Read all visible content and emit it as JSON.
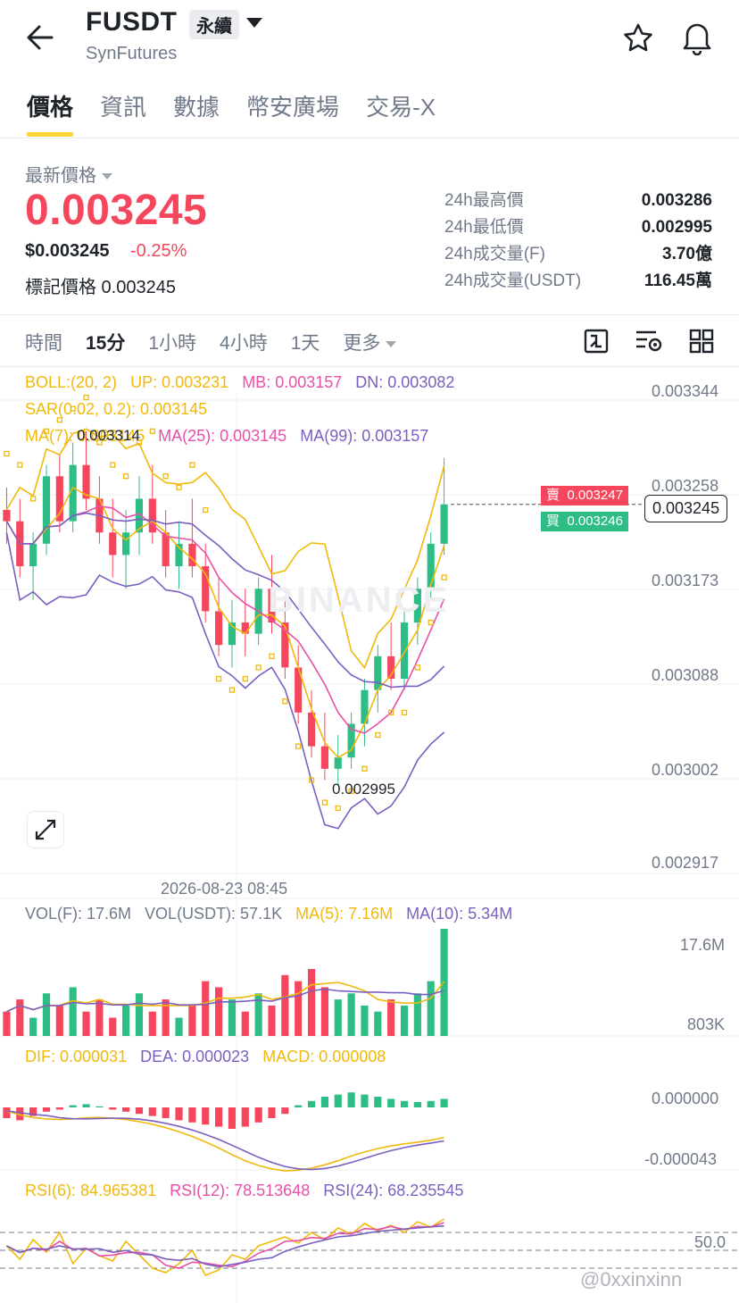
{
  "header": {
    "back_icon": "arrow-left-icon",
    "symbol": "FUSDT",
    "contract_type": "永續",
    "exchange": "SynFutures",
    "star_icon": "star-icon",
    "bell_icon": "bell-icon"
  },
  "tabs": [
    {
      "label": "價格",
      "active": true
    },
    {
      "label": "資訊",
      "active": false
    },
    {
      "label": "數據",
      "active": false
    },
    {
      "label": "幣安廣場",
      "active": false
    },
    {
      "label": "交易-X",
      "active": false
    }
  ],
  "summary": {
    "latest_label": "最新價格",
    "last_price": "0.003245",
    "usd_price": "$0.003245",
    "change": "-0.25%",
    "mark_label": "標記價格 0.003245",
    "stats": [
      {
        "label": "24h最高價",
        "value": "0.003286"
      },
      {
        "label": "24h最低價",
        "value": "0.002995"
      },
      {
        "label": "24h成交量(F)",
        "value": "3.70億"
      },
      {
        "label": "24h成交量(USDT)",
        "value": "116.45萬"
      }
    ]
  },
  "intervals": [
    {
      "label": "時間",
      "active": false
    },
    {
      "label": "15分",
      "active": true
    },
    {
      "label": "1小時",
      "active": false
    },
    {
      "label": "4小時",
      "active": false
    },
    {
      "label": "1天",
      "active": false
    },
    {
      "label": "更多",
      "active": false
    }
  ],
  "toolbar_icons": [
    "chart-type-icon",
    "indicator-settings-icon",
    "layout-grid-icon"
  ],
  "indicators": {
    "boll": {
      "label": "BOLL:(20, 2)",
      "up": "UP: 0.003231",
      "mb": "MB: 0.003157",
      "dn": "DN: 0.003082"
    },
    "sar": "SAR(0.02, 0.2): 0.003145",
    "ma": {
      "ma7": "MA(7): 0.003145",
      "ma25": "MA(25): 0.003145",
      "ma99": "MA(99): 0.003157"
    },
    "vol": {
      "volf": "VOL(F): 17.6M",
      "volusdt": "VOL(USDT): 57.1K",
      "ma5": "MA(5): 7.16M",
      "ma10": "MA(10): 5.34M"
    },
    "macd": {
      "dif": "DIF: 0.000031",
      "dea": "DEA: 0.000023",
      "macd": "MACD: 0.000008"
    },
    "rsi": {
      "rsi6": "RSI(6): 84.965381",
      "rsi12": "RSI(12): 78.513648",
      "rsi24": "RSI(24): 68.235545"
    }
  },
  "price_axis": [
    "0.003344",
    "0.003258",
    "0.003173",
    "0.003088",
    "0.003002",
    "0.002917"
  ],
  "chart_annotations": {
    "high": "0.003314",
    "low": "0.002995",
    "time": "2026-08-23 08:45"
  },
  "order_tags": {
    "sell_label": "賣",
    "sell_value": "0.003247",
    "buy_label": "買",
    "buy_value": "0.003246",
    "current": "0.003245"
  },
  "vol_axis": [
    "17.6M",
    "803K"
  ],
  "macd_axis": [
    "0.000000",
    "-0.000043"
  ],
  "rsi_axis": [
    "50.0"
  ],
  "watermark": "BINANCE",
  "footer_watermark": "@0xxinxinn",
  "colors": {
    "up": "#2ebd85",
    "down": "#f6465d",
    "accent": "#fcd535",
    "boll": "#f0b90b",
    "ma25": "#e84fa8",
    "ma99": "#7b5fc0"
  },
  "chart_data": {
    "type": "candlestick",
    "interval": "15分",
    "ylim": [
      0.002917,
      0.003344
    ],
    "series_overlays": [
      "BOLL",
      "SAR",
      "MA(7)",
      "MA(25)",
      "MA(99)"
    ],
    "candles": [
      [
        0.00324,
        0.00326,
        0.00321,
        0.00323
      ],
      [
        0.00323,
        0.00325,
        0.00318,
        0.00319
      ],
      [
        0.00319,
        0.00322,
        0.00316,
        0.00321
      ],
      [
        0.00321,
        0.00328,
        0.0032,
        0.00327
      ],
      [
        0.00327,
        0.00329,
        0.00322,
        0.00323
      ],
      [
        0.00323,
        0.0033,
        0.00322,
        0.00328
      ],
      [
        0.00328,
        0.00331,
        0.00324,
        0.00325
      ],
      [
        0.00325,
        0.00327,
        0.00321,
        0.00322
      ],
      [
        0.00322,
        0.00325,
        0.00318,
        0.0032
      ],
      [
        0.0032,
        0.00324,
        0.00317,
        0.00322
      ],
      [
        0.00322,
        0.00327,
        0.0032,
        0.00325
      ],
      [
        0.00325,
        0.00328,
        0.00321,
        0.00322
      ],
      [
        0.00322,
        0.00324,
        0.00318,
        0.00319
      ],
      [
        0.00319,
        0.00323,
        0.00317,
        0.00321
      ],
      [
        0.00321,
        0.00325,
        0.00318,
        0.00319
      ],
      [
        0.00319,
        0.00321,
        0.00314,
        0.00315
      ],
      [
        0.00315,
        0.00318,
        0.00311,
        0.00312
      ],
      [
        0.00312,
        0.00316,
        0.0031,
        0.00314
      ],
      [
        0.00314,
        0.00317,
        0.00311,
        0.00313
      ],
      [
        0.00313,
        0.00318,
        0.00312,
        0.00317
      ],
      [
        0.00317,
        0.0032,
        0.00313,
        0.00314
      ],
      [
        0.00314,
        0.00316,
        0.00309,
        0.0031
      ],
      [
        0.0031,
        0.00312,
        0.00305,
        0.00306
      ],
      [
        0.00306,
        0.00308,
        0.00302,
        0.00303
      ],
      [
        0.00303,
        0.00306,
        0.003,
        0.00301
      ],
      [
        0.00301,
        0.00304,
        0.002995,
        0.00302
      ],
      [
        0.00302,
        0.00306,
        0.00301,
        0.00305
      ],
      [
        0.00305,
        0.00309,
        0.00303,
        0.00308
      ],
      [
        0.00308,
        0.00312,
        0.00306,
        0.00311
      ],
      [
        0.00311,
        0.00314,
        0.00308,
        0.00309
      ],
      [
        0.00309,
        0.00315,
        0.00308,
        0.00314
      ],
      [
        0.00314,
        0.00318,
        0.00312,
        0.00317
      ],
      [
        0.00317,
        0.00322,
        0.00316,
        0.00321
      ],
      [
        0.00321,
        0.003286,
        0.0032,
        0.003245
      ]
    ],
    "volume": [
      4,
      6,
      3,
      7,
      5,
      8,
      4,
      6,
      3,
      5,
      7,
      4,
      6,
      3,
      5,
      9,
      8,
      6,
      4,
      7,
      5,
      10,
      9,
      11,
      8,
      6,
      7,
      5,
      4,
      6,
      5,
      7,
      9,
      17.6
    ],
    "macd": [
      -1e-05,
      -1.2e-05,
      -8e-06,
      -4e-06,
      -2e-06,
      2e-06,
      3e-06,
      1e-06,
      -2e-06,
      -4e-06,
      -6e-06,
      -8e-06,
      -1e-05,
      -1.2e-05,
      -1.4e-05,
      -1.6e-05,
      -1.8e-05,
      -2e-05,
      -1.8e-05,
      -1.4e-05,
      -1e-05,
      -6e-06,
      2e-06,
      6e-06,
      1e-05,
      1.2e-05,
      1.4e-05,
      1.2e-05,
      1e-05,
      8e-06,
      6e-06,
      5e-06,
      6e-06,
      8e-06
    ],
    "rsi6": [
      55,
      40,
      62,
      48,
      70,
      35,
      52,
      44,
      38,
      60,
      45,
      30,
      25,
      35,
      50,
      22,
      28,
      45,
      40,
      55,
      60,
      65,
      58,
      70,
      62,
      75,
      68,
      80,
      72,
      78,
      70,
      82,
      76,
      85
    ]
  }
}
